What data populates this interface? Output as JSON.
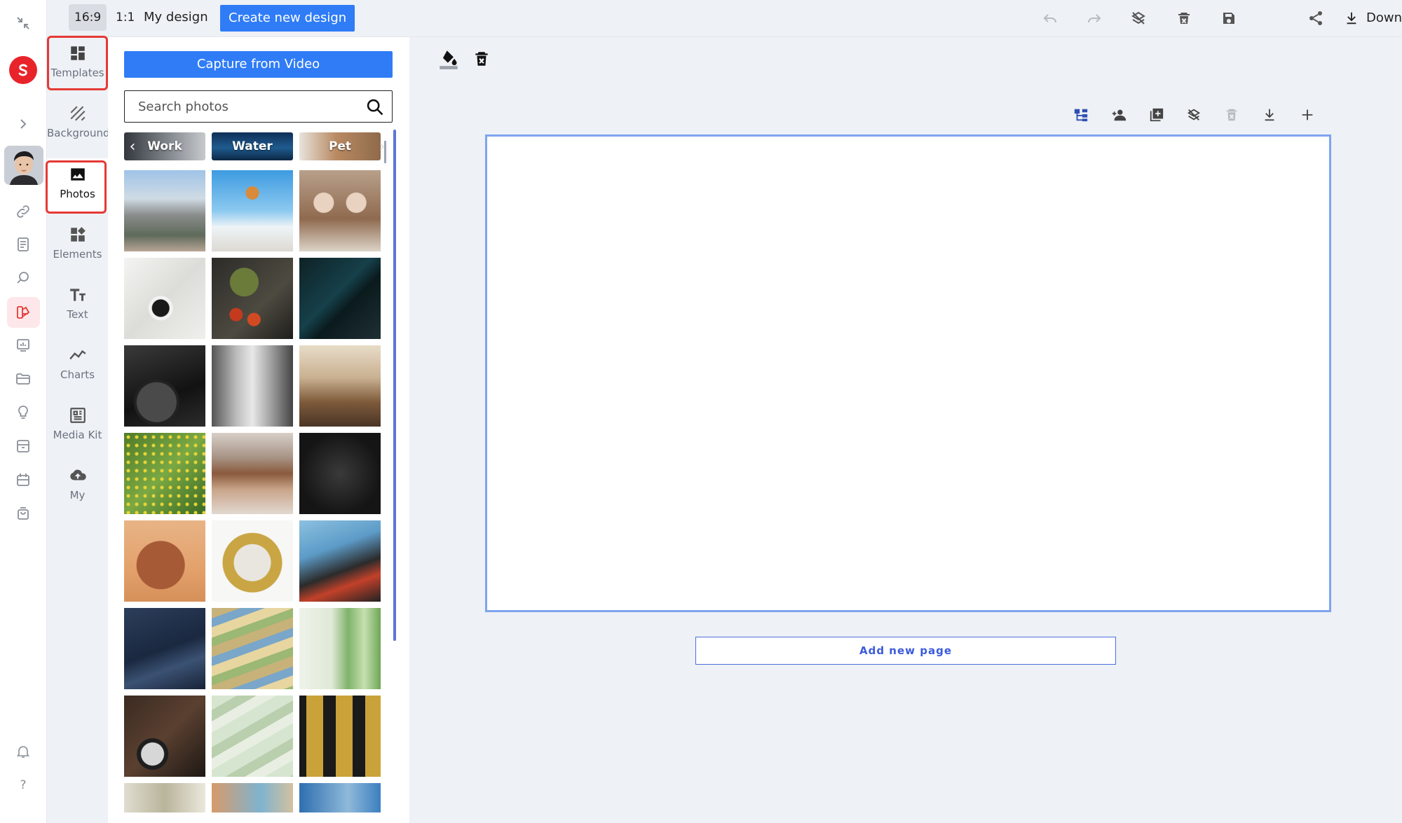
{
  "topbar": {
    "ratio_169": "16:9",
    "ratio_11": "1:1",
    "my_design": "My design",
    "create_new": "Create new design",
    "download": "Download"
  },
  "categories": [
    {
      "label": "Templates",
      "icon": "templates-icon"
    },
    {
      "label": "Background",
      "icon": "background-icon"
    },
    {
      "label": "Photos",
      "icon": "photo-icon"
    },
    {
      "label": "Elements",
      "icon": "elements-icon"
    },
    {
      "label": "Text",
      "icon": "text-icon"
    },
    {
      "label": "Charts",
      "icon": "chart-icon"
    },
    {
      "label": "Media Kit",
      "icon": "media-kit-icon"
    },
    {
      "label": "My",
      "icon": "cloud-upload-icon"
    }
  ],
  "panel": {
    "capture_label": "Capture from Video",
    "search_placeholder": "Search photos",
    "chips": [
      "Work",
      "Water",
      "Pet"
    ]
  },
  "canvas": {
    "add_page": "Add new page"
  },
  "rail": {
    "help": "?"
  },
  "colors": {
    "accent": "#2f7cf6",
    "highlight": "#e53935",
    "page_border": "#7ea4f0",
    "add_page_text": "#3b5bdb"
  }
}
